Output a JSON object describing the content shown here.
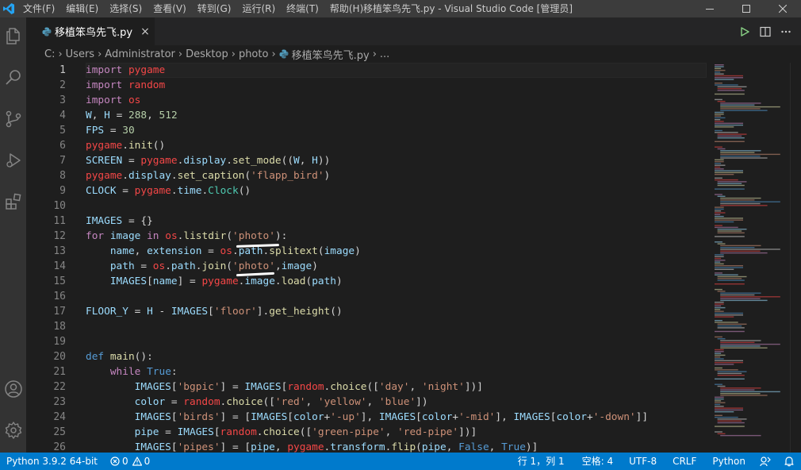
{
  "window": {
    "title": "移植笨鸟先飞.py - Visual Studio Code [管理员]"
  },
  "menu": [
    {
      "label": "文件(F)"
    },
    {
      "label": "编辑(E)"
    },
    {
      "label": "选择(S)"
    },
    {
      "label": "查看(V)"
    },
    {
      "label": "转到(G)"
    },
    {
      "label": "运行(R)"
    },
    {
      "label": "终端(T)"
    },
    {
      "label": "帮助(H)"
    }
  ],
  "tab": {
    "label": "移植笨鸟先飞.py",
    "close": "×"
  },
  "breadcrumb": {
    "items": [
      "C:",
      "Users",
      "Administrator",
      "Desktop",
      "photo",
      "移植笨鸟先飞.py",
      "..."
    ],
    "sep": "›"
  },
  "editor": {
    "lines": [
      {
        "n": "1",
        "text": "import pygame"
      },
      {
        "n": "2",
        "text": "import random"
      },
      {
        "n": "3",
        "text": "import os"
      },
      {
        "n": "4",
        "text": "W, H = 288, 512"
      },
      {
        "n": "5",
        "text": "FPS = 30"
      },
      {
        "n": "6",
        "text": "pygame.init()"
      },
      {
        "n": "7",
        "text": "SCREEN = pygame.display.set_mode((W, H))"
      },
      {
        "n": "8",
        "text": "pygame.display.set_caption('flapp_bird')"
      },
      {
        "n": "9",
        "text": "CLOCK = pygame.time.Clock()"
      },
      {
        "n": "10",
        "text": ""
      },
      {
        "n": "11",
        "text": "IMAGES = {}"
      },
      {
        "n": "12",
        "text": "for image in os.listdir('photo'):"
      },
      {
        "n": "13",
        "text": "    name, extension = os.path.splitext(image)"
      },
      {
        "n": "14",
        "text": "    path = os.path.join('photo',image)"
      },
      {
        "n": "15",
        "text": "    IMAGES[name] = pygame.image.load(path)"
      },
      {
        "n": "16",
        "text": ""
      },
      {
        "n": "17",
        "text": "FLOOR_Y = H - IMAGES['floor'].get_height()"
      },
      {
        "n": "18",
        "text": ""
      },
      {
        "n": "19",
        "text": ""
      },
      {
        "n": "20",
        "text": "def main():"
      },
      {
        "n": "21",
        "text": "    while True:"
      },
      {
        "n": "22",
        "text": "        IMAGES['bgpic'] = IMAGES[random.choice(['day', 'night'])]"
      },
      {
        "n": "23",
        "text": "        color = random.choice(['red', 'yellow', 'blue'])"
      },
      {
        "n": "24",
        "text": "        IMAGES['birds'] = [IMAGES[color+'-up'], IMAGES[color+'-mid'], IMAGES[color+'-down']]"
      },
      {
        "n": "25",
        "text": "        pipe = IMAGES[random.choice(['green-pipe', 'red-pipe'])]"
      },
      {
        "n": "26",
        "text": "        IMAGES['pipes'] = [pipe, pygame.transform.flip(pipe, False, True)]"
      }
    ]
  },
  "status": {
    "interpreter": "Python 3.9.2 64-bit",
    "errors": "0",
    "warnings": "0",
    "position": "行 1，列 1",
    "spaces": "空格: 4",
    "encoding": "UTF-8",
    "eol": "CRLF",
    "language": "Python"
  },
  "colors": {
    "accent": "#007acc",
    "titlebar": "#3c3c3c",
    "activitybar": "#333333",
    "editor": "#1e1e1e",
    "python_icon": "#519aba"
  }
}
